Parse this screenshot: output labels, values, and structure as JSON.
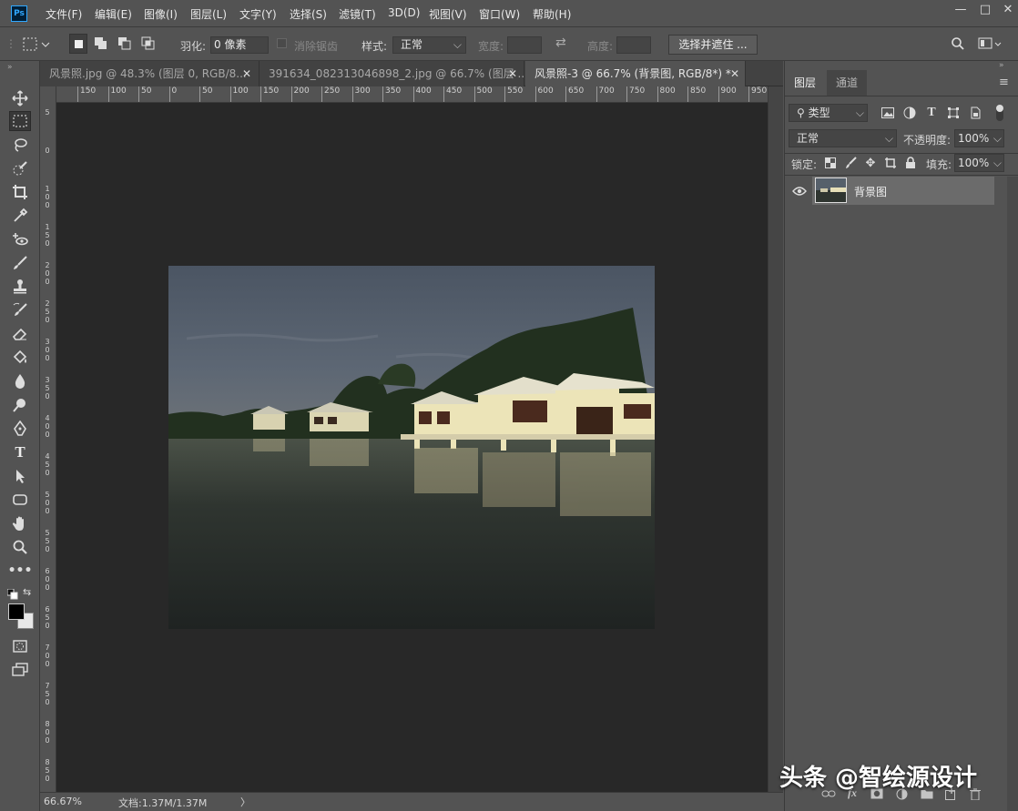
{
  "menubar": {
    "logo": "Ps",
    "items": [
      "文件(F)",
      "编辑(E)",
      "图像(I)",
      "图层(L)",
      "文字(Y)",
      "选择(S)",
      "滤镜(T)",
      "3D(D)",
      "视图(V)",
      "窗口(W)",
      "帮助(H)"
    ],
    "window_controls": [
      "—",
      "□",
      "✕"
    ]
  },
  "options": {
    "feather_label": "羽化:",
    "feather_value": "0 像素",
    "antialias_label": "消除锯齿",
    "style_label": "样式:",
    "style_value": "正常",
    "width_label": "宽度:",
    "height_label": "高度:",
    "select_mask_button": "选择并遮住 ..."
  },
  "tabs": [
    {
      "label": "风景照.jpg @ 48.3% (图层 0, RGB/8...",
      "close": "✕",
      "active": false
    },
    {
      "label": "391634_082313046898_2.jpg @ 66.7% (图层 ...",
      "close": "✕",
      "active": false
    },
    {
      "label": "风景照-3 @ 66.7% (背景图, RGB/8*) *",
      "close": "✕",
      "active": true
    }
  ],
  "ruler": {
    "h_ticks": [
      "150",
      "100",
      "50",
      "0",
      "50",
      "100",
      "150",
      "200",
      "250",
      "300",
      "350",
      "400",
      "450",
      "500",
      "550",
      "600",
      "650",
      "700",
      "750",
      "800",
      "850",
      "900",
      "950"
    ],
    "v_ticks": [
      "5",
      "0",
      "1\n0\n0",
      "1\n5\n0",
      "2\n0\n0",
      "2\n5\n0",
      "3\n0\n0",
      "3\n5\n0",
      "4\n0\n0",
      "4\n5\n0",
      "5\n0\n0",
      "5\n5\n0",
      "6\n0\n0",
      "6\n5\n0",
      "7\n0\n0",
      "7\n5\n0",
      "8\n0\n0",
      "8\n5\n0"
    ]
  },
  "status": {
    "zoom": "66.67%",
    "doc": "文档:1.37M/1.37M",
    "arrow": "〉"
  },
  "panel": {
    "tabs": [
      "图层",
      "通道"
    ],
    "filter_kind": "类型",
    "blend_mode": "正常",
    "opacity_label": "不透明度:",
    "opacity_value": "100%",
    "lock_label": "锁定:",
    "fill_label": "填充:",
    "fill_value": "100%",
    "layers": [
      {
        "name": "背景图",
        "visible": true
      }
    ],
    "bottom_icons": [
      "link-icon",
      "fx",
      "mask-icon",
      "adjustment-icon",
      "folder-icon",
      "new-layer-icon",
      "trash-icon"
    ],
    "fx_label": "fx"
  },
  "watermark": "头条 @智绘源设计"
}
